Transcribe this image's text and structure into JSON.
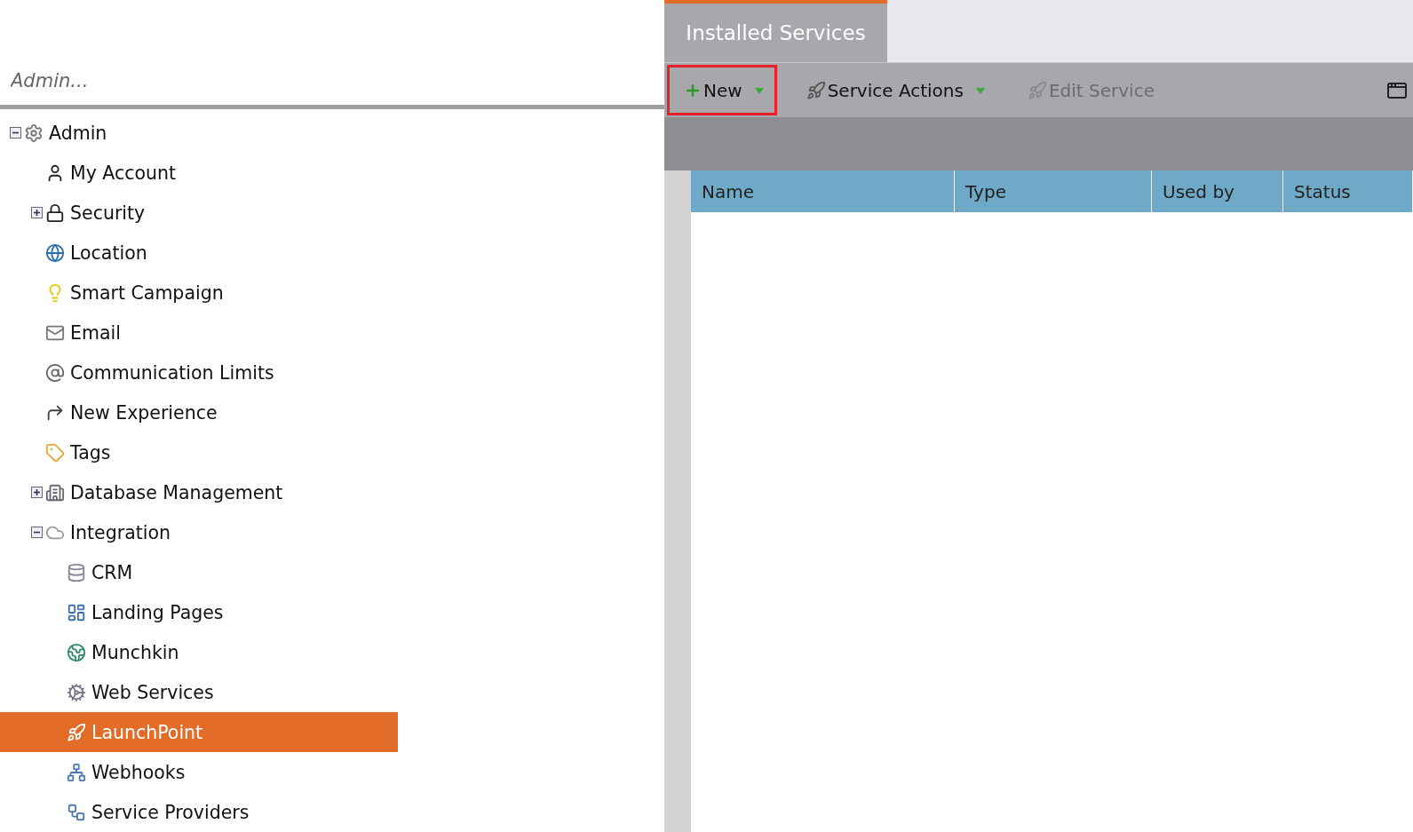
{
  "search": {
    "placeholder": "Admin..."
  },
  "tree": [
    {
      "label": "Admin",
      "expanded": true,
      "selected": false,
      "children": [
        {
          "label": "My Account",
          "selected": false
        },
        {
          "label": "Security",
          "expanded": false,
          "selected": false
        },
        {
          "label": "Location",
          "selected": false
        },
        {
          "label": "Smart Campaign",
          "selected": false
        },
        {
          "label": "Email",
          "selected": false
        },
        {
          "label": "Communication Limits",
          "selected": false
        },
        {
          "label": "New Experience",
          "selected": false
        },
        {
          "label": "Tags",
          "selected": false
        },
        {
          "label": "Database Management",
          "expanded": false,
          "selected": false
        },
        {
          "label": "Integration",
          "expanded": true,
          "selected": false,
          "children": [
            {
              "label": "CRM",
              "selected": false
            },
            {
              "label": "Landing Pages",
              "selected": false
            },
            {
              "label": "Munchkin",
              "selected": false
            },
            {
              "label": "Web Services",
              "selected": false
            },
            {
              "label": "LaunchPoint",
              "selected": true
            },
            {
              "label": "Webhooks",
              "selected": false
            },
            {
              "label": "Service Providers",
              "selected": false
            }
          ]
        }
      ]
    }
  ],
  "tabs": [
    {
      "label": "Installed Services",
      "selected": true
    }
  ],
  "toolbar": [
    {
      "label": "New",
      "dropdown": true,
      "disabled": false,
      "outlined": true
    },
    {
      "label": "Service Actions",
      "dropdown": true,
      "disabled": false,
      "outlined": false
    },
    {
      "label": "Edit Service",
      "dropdown": false,
      "disabled": true,
      "outlined": false
    }
  ],
  "table": {
    "columns": [
      "Name",
      "Type",
      "Used by",
      "Status"
    ]
  }
}
